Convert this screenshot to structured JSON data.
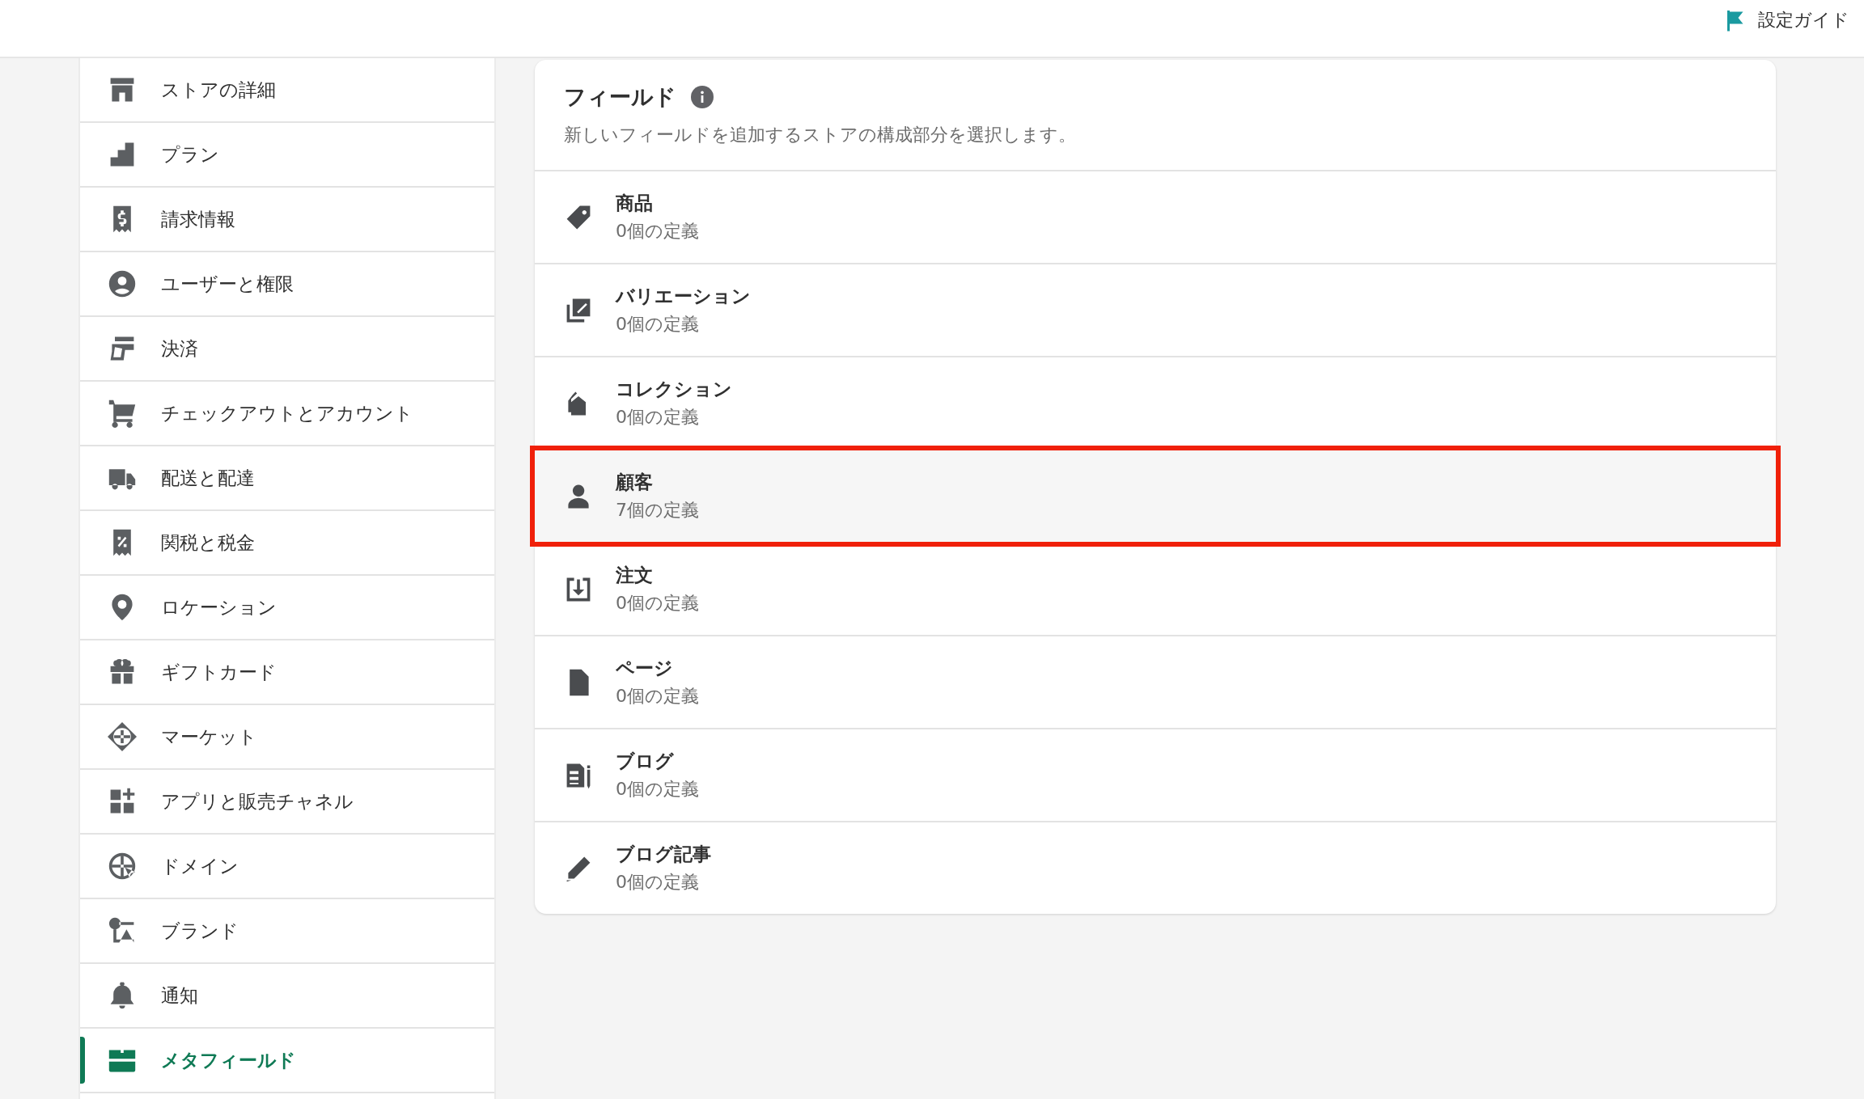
{
  "top_bar": {
    "guide_link": "設定ガイド"
  },
  "sidebar": {
    "items": [
      {
        "label": "ストアの詳細",
        "selected": false
      },
      {
        "label": "プラン",
        "selected": false
      },
      {
        "label": "請求情報",
        "selected": false
      },
      {
        "label": "ユーザーと権限",
        "selected": false
      },
      {
        "label": "決済",
        "selected": false
      },
      {
        "label": "チェックアウトとアカウント",
        "selected": false
      },
      {
        "label": "配送と配達",
        "selected": false
      },
      {
        "label": "関税と税金",
        "selected": false
      },
      {
        "label": "ロケーション",
        "selected": false
      },
      {
        "label": "ギフトカード",
        "selected": false
      },
      {
        "label": "マーケット",
        "selected": false
      },
      {
        "label": "アプリと販売チャネル",
        "selected": false
      },
      {
        "label": "ドメイン",
        "selected": false
      },
      {
        "label": "ブランド",
        "selected": false
      },
      {
        "label": "通知",
        "selected": false
      },
      {
        "label": "メタフィールド",
        "selected": true
      }
    ]
  },
  "card": {
    "title": "フィールド",
    "description": "新しいフィールドを追加するストアの構成部分を選択します。",
    "rows": [
      {
        "title": "商品",
        "count": "0個の定義",
        "highlighted": false
      },
      {
        "title": "バリエーション",
        "count": "0個の定義",
        "highlighted": false
      },
      {
        "title": "コレクション",
        "count": "0個の定義",
        "highlighted": false
      },
      {
        "title": "顧客",
        "count": "7個の定義",
        "highlighted": true
      },
      {
        "title": "注文",
        "count": "0個の定義",
        "highlighted": false
      },
      {
        "title": "ページ",
        "count": "0個の定義",
        "highlighted": false
      },
      {
        "title": "ブログ",
        "count": "0個の定義",
        "highlighted": false
      },
      {
        "title": "ブログ記事",
        "count": "0個の定義",
        "highlighted": false
      }
    ]
  }
}
